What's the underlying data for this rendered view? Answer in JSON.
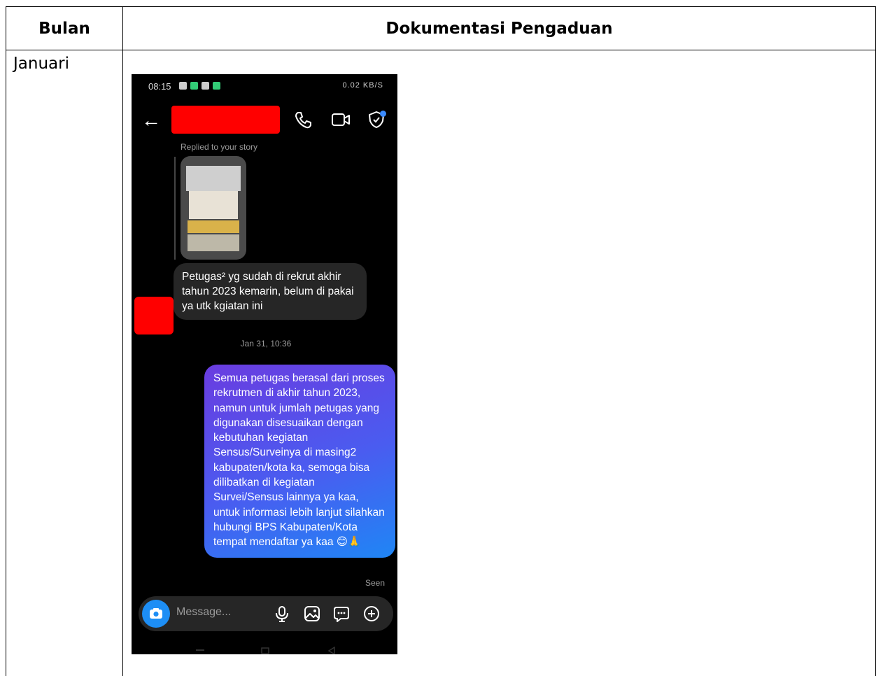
{
  "table": {
    "header_month": "Bulan",
    "header_doc": "Dokumentasi Pengaduan",
    "month": "Januari"
  },
  "phone": {
    "status_time": "08:15",
    "status_right": "0.02 KB/S",
    "replied_label": "Replied to your story",
    "incoming_message": "Petugas² yg sudah di rekrut akhir tahun 2023 kemarin, belum di pakai ya utk kgiatan ini",
    "timestamp": "Jan 31, 10:36",
    "outgoing_message": "Semua petugas berasal dari proses rekrutmen di akhir tahun 2023, namun untuk jumlah petugas yang digunakan disesuaikan dengan kebutuhan kegiatan Sensus/Surveinya di masing2 kabupaten/kota ka, semoga bisa dilibatkan di kegiatan Survei/Sensus lainnya ya kaa, untuk informasi lebih lanjut silahkan hubungi BPS Kabupaten/Kota tempat mendaftar ya kaa 😊🙏",
    "seen_label": "Seen",
    "composer_placeholder": "Message...",
    "colors": {
      "redacted": "#ff0000",
      "out_bubble_start": "#6a3ce0",
      "out_bubble_end": "#1f86f5",
      "camera_button": "#1d8ef5"
    }
  }
}
